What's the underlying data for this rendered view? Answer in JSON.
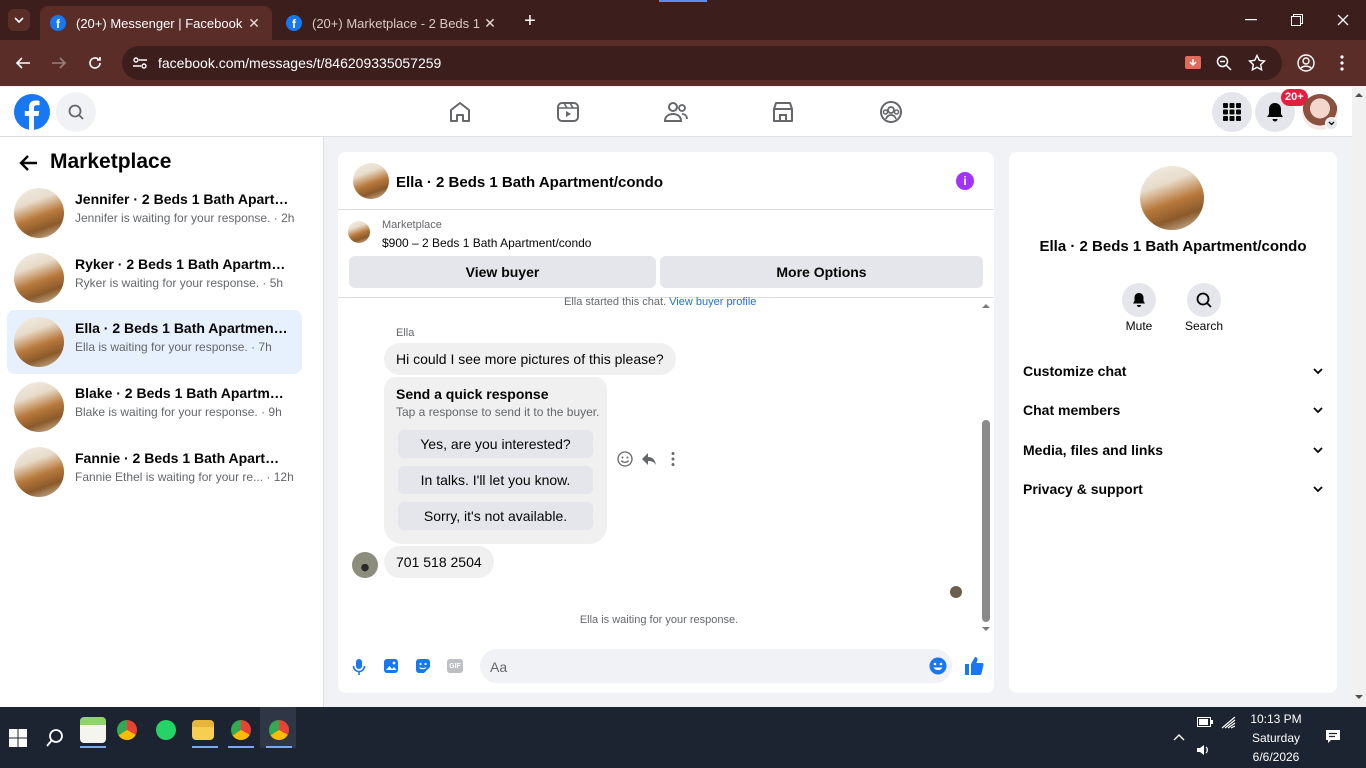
{
  "browser": {
    "tabs": [
      {
        "title": "(20+) Messenger | Facebook",
        "active": true
      },
      {
        "title": "(20+) Marketplace - 2 Beds 1 Bath",
        "active": false
      }
    ],
    "url": "facebook.com/messages/t/846209335057259"
  },
  "header": {
    "notification_badge": "20+"
  },
  "sidebar": {
    "title": "Marketplace",
    "conversations": [
      {
        "name": "Jennifer · 2 Beds 1 Bath Apartm...",
        "preview": "Jennifer is waiting for your response. · 2h"
      },
      {
        "name": "Ryker · 2 Beds 1 Bath Apartment...",
        "preview": "Ryker is waiting for your response. · 5h"
      },
      {
        "name": "Ella · 2 Beds 1 Bath Apartment/c...",
        "preview": "Ella is waiting for your response. · 7h",
        "selected": true
      },
      {
        "name": "Blake · 2 Beds 1 Bath Apartment...",
        "preview": "Blake is waiting for your response. · 9h"
      },
      {
        "name": "Fannie · 2 Beds 1 Bath Apartmen...",
        "preview": "Fannie Ethel is waiting for your re... · 12h"
      }
    ]
  },
  "chat": {
    "title": "Ella · 2 Beds 1 Bath Apartment/condo",
    "listing_source": "Marketplace",
    "listing_title": "$900 – 2 Beds 1 Bath Apartment/condo",
    "view_buyer_label": "View buyer",
    "more_options_label": "More Options",
    "started_text": "Ella started this chat.",
    "view_profile_link": "View buyer profile",
    "sender_name": "Ella",
    "message_1": "Hi could I see more pictures of this please?",
    "quick_title": "Send a quick response",
    "quick_subtitle": "Tap a response to send it to the buyer.",
    "quick_responses": [
      "Yes, are you interested?",
      "In talks. I'll let you know.",
      "Sorry, it's not available."
    ],
    "message_2": "701 518 2504",
    "waiting_text": "Ella is waiting for your response.",
    "composer_placeholder": "Aa"
  },
  "info_panel": {
    "title": "Ella · 2 Beds 1 Bath Apartment/condo",
    "mute_label": "Mute",
    "search_label": "Search",
    "sections": [
      "Customize chat",
      "Chat members",
      "Media, files and links",
      "Privacy & support"
    ]
  },
  "taskbar": {
    "time": "10:13 PM",
    "day": "Saturday",
    "date": "6/6/2026"
  },
  "colors": {
    "brand": "#1877f2",
    "chrome_dark": "#3c1f1c",
    "chrome_mid": "#5a2d28",
    "selected": "#e7f0fd",
    "badge": "#e41e3f",
    "info_purple": "#a033ff"
  }
}
